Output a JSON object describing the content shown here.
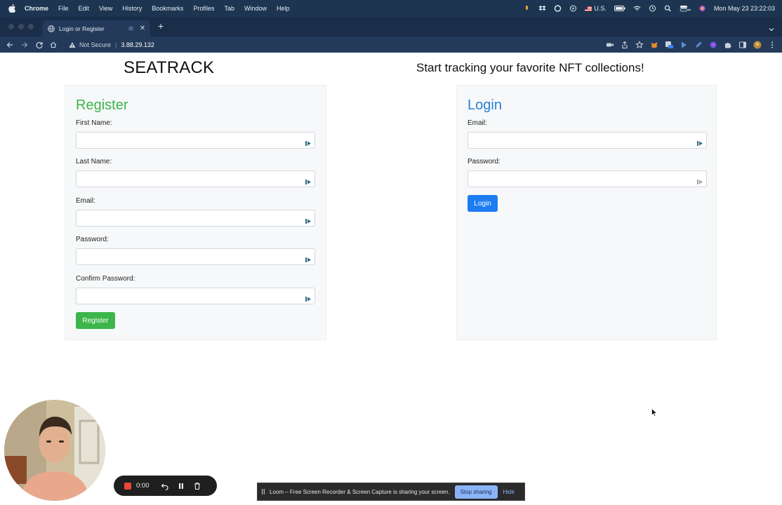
{
  "menubar": {
    "app": "Chrome",
    "items": [
      "File",
      "Edit",
      "View",
      "History",
      "Bookmarks",
      "Profiles",
      "Tab",
      "Window",
      "Help"
    ],
    "input_source": "U.S.",
    "clock": "Mon May 23  23:22:03"
  },
  "browser": {
    "tab_title": "Login or Register",
    "security_label": "Not Secure",
    "url": "3.88.29.132"
  },
  "page": {
    "brand": "SEATRACK",
    "tagline": "Start tracking your favorite NFT collections!",
    "register": {
      "heading": "Register",
      "fields": [
        {
          "label": "First Name:",
          "value": ""
        },
        {
          "label": "Last Name:",
          "value": ""
        },
        {
          "label": "Email:",
          "value": ""
        },
        {
          "label": "Password:",
          "value": ""
        },
        {
          "label": "Confirm Password:",
          "value": ""
        }
      ],
      "submit": "Register"
    },
    "login": {
      "heading": "Login",
      "fields": [
        {
          "label": "Email:",
          "value": ""
        },
        {
          "label": "Password:",
          "value": ""
        }
      ],
      "submit": "Login"
    }
  },
  "recorder": {
    "timer": "0:00"
  },
  "share_notice": {
    "message": "Loom – Free Screen Recorder & Screen Capture is sharing your screen.",
    "stop_label": "Stop sharing",
    "hide_label": "Hide"
  },
  "colors": {
    "register_accent": "#3cb54a",
    "login_accent": "#2b7fd4",
    "login_button": "#1d7cf2",
    "recording": "#e8453c"
  }
}
